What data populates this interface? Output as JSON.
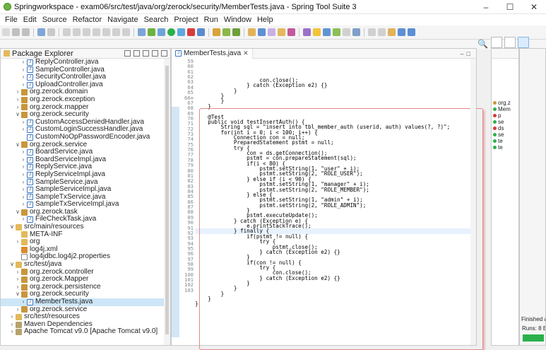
{
  "window": {
    "title": "Springworkspace - exam06/src/test/java/org/zerock/security/MemberTests.java - Spring Tool Suite 3",
    "controls": [
      "–",
      "☐",
      "✕"
    ]
  },
  "menu": [
    "File",
    "Edit",
    "Source",
    "Refactor",
    "Navigate",
    "Search",
    "Project",
    "Run",
    "Window",
    "Help"
  ],
  "package_explorer": {
    "title": "Package Explorer",
    "tree": [
      {
        "label": "ReplyController.java",
        "indent": 3,
        "icon": "java",
        "arrow": ">"
      },
      {
        "label": "SampleController.java",
        "indent": 3,
        "icon": "java",
        "arrow": ">"
      },
      {
        "label": "SecurityController.java",
        "indent": 3,
        "icon": "java",
        "arrow": ">"
      },
      {
        "label": "UploadController.java",
        "indent": 3,
        "icon": "java",
        "arrow": ">"
      },
      {
        "label": "org.zerock.domain",
        "indent": 2,
        "icon": "pkgi",
        "arrow": ">"
      },
      {
        "label": "org.zerock.exception",
        "indent": 2,
        "icon": "pkgi",
        "arrow": ">"
      },
      {
        "label": "org.zerock.mapper",
        "indent": 2,
        "icon": "pkgi",
        "arrow": ">"
      },
      {
        "label": "org.zerock.security",
        "indent": 2,
        "icon": "pkgi",
        "arrow": "v"
      },
      {
        "label": "CustomAccessDeniedHandler.java",
        "indent": 3,
        "icon": "java",
        "arrow": ">"
      },
      {
        "label": "CustomLoginSuccessHandler.java",
        "indent": 3,
        "icon": "java",
        "arrow": ">"
      },
      {
        "label": "CustomNoOpPasswordEncoder.java",
        "indent": 3,
        "icon": "java",
        "arrow": ""
      },
      {
        "label": "org.zerock.service",
        "indent": 2,
        "icon": "pkgi",
        "arrow": "v"
      },
      {
        "label": "BoardService.java",
        "indent": 3,
        "icon": "java",
        "arrow": ">"
      },
      {
        "label": "BoardServiceImpl.java",
        "indent": 3,
        "icon": "java",
        "arrow": ">"
      },
      {
        "label": "ReplyService.java",
        "indent": 3,
        "icon": "java",
        "arrow": ">"
      },
      {
        "label": "ReplyServiceImpl.java",
        "indent": 3,
        "icon": "java",
        "arrow": ">"
      },
      {
        "label": "SampleService.java",
        "indent": 3,
        "icon": "java",
        "arrow": ">"
      },
      {
        "label": "SampleServiceImpl.java",
        "indent": 3,
        "icon": "java",
        "arrow": ">"
      },
      {
        "label": "SampleTxService.java",
        "indent": 3,
        "icon": "java",
        "arrow": ">"
      },
      {
        "label": "SampleTxServiceImpl.java",
        "indent": 3,
        "icon": "java",
        "arrow": ">"
      },
      {
        "label": "org.zerock.task",
        "indent": 2,
        "icon": "pkgi",
        "arrow": "v"
      },
      {
        "label": "FileCheckTask.java",
        "indent": 3,
        "icon": "java",
        "arrow": ">"
      },
      {
        "label": "src/main/resources",
        "indent": 1,
        "icon": "folder",
        "arrow": "v"
      },
      {
        "label": "META-INF",
        "indent": 2,
        "icon": "folder",
        "arrow": ""
      },
      {
        "label": "org",
        "indent": 2,
        "icon": "folder",
        "arrow": ">"
      },
      {
        "label": "log4j.xml",
        "indent": 2,
        "icon": "xml",
        "arrow": ""
      },
      {
        "label": "log4jdbc.log4j2.properties",
        "indent": 2,
        "icon": "file",
        "arrow": ""
      },
      {
        "label": "src/test/java",
        "indent": 1,
        "icon": "folder",
        "arrow": "v"
      },
      {
        "label": "org.zerock.controller",
        "indent": 2,
        "icon": "pkgi",
        "arrow": ">"
      },
      {
        "label": "org.zerock.Mapper",
        "indent": 2,
        "icon": "pkgi",
        "arrow": ">"
      },
      {
        "label": "org.zerock.persistence",
        "indent": 2,
        "icon": "pkgi",
        "arrow": ">"
      },
      {
        "label": "org.zerock.security",
        "indent": 2,
        "icon": "pkgi",
        "arrow": "v"
      },
      {
        "label": "MemberTests.java",
        "indent": 3,
        "icon": "java",
        "arrow": ">",
        "selected": true
      },
      {
        "label": "org.zerock.service",
        "indent": 2,
        "icon": "pkgi",
        "arrow": ">"
      },
      {
        "label": "src/test/resources",
        "indent": 1,
        "icon": "folder",
        "arrow": ">"
      },
      {
        "label": "Maven Dependencies",
        "indent": 1,
        "icon": "lib",
        "arrow": ">"
      },
      {
        "label": "Apache Tomcat v9.0 [Apache Tomcat v9.0]",
        "indent": 1,
        "icon": "lib",
        "arrow": ">"
      }
    ]
  },
  "editor": {
    "tab_label": "MemberTests.java",
    "lines": [
      {
        "n": "59",
        "t": "                    con.close();"
      },
      {
        "n": "60",
        "t": "                } catch (Exception e2) {}"
      },
      {
        "n": "61",
        "t": "            }"
      },
      {
        "n": "62",
        "t": "        }"
      },
      {
        "n": "63",
        "t": "        }"
      },
      {
        "n": "64",
        "t": "    }"
      },
      {
        "n": "65",
        "t": ""
      },
      {
        "n": "66⊖",
        "t": "    @Test"
      },
      {
        "n": "67",
        "t": "    public void testInsertAuth() {"
      },
      {
        "n": "68",
        "t": "        String sql = \"insert into tbl_member_auth (userid, auth) values(?, ?)\";"
      },
      {
        "n": "69",
        "t": "        for(int i = 0; i < 100; i++) {"
      },
      {
        "n": "70",
        "t": "            Connection con = null;"
      },
      {
        "n": "71",
        "t": "            PreparedStatement pstmt = null;"
      },
      {
        "n": "72",
        "t": "            try {"
      },
      {
        "n": "73",
        "t": "                con = ds.getConnection();"
      },
      {
        "n": "74",
        "t": "                pstmt = con.prepareStatement(sql);"
      },
      {
        "n": "75",
        "t": "                if(i < 80) {"
      },
      {
        "n": "76",
        "t": "                    pstmt.setString(1, \"user\" + i);"
      },
      {
        "n": "77",
        "t": "                    pstmt.setString(2, \"ROLE_USER\");"
      },
      {
        "n": "78",
        "t": "                } else if (i < 90) {"
      },
      {
        "n": "79",
        "t": "                    pstmt.setString(1, \"manager\" + i);"
      },
      {
        "n": "80",
        "t": "                    pstmt.setString(2, \"ROLE_MEMBER\");"
      },
      {
        "n": "81",
        "t": "                } else {"
      },
      {
        "n": "82",
        "t": "                    pstmt.setString(1, \"admin\" + i);"
      },
      {
        "n": "83",
        "t": "                    pstmt.setString(2, \"ROLE_ADMIN\");"
      },
      {
        "n": "84",
        "t": "                }"
      },
      {
        "n": "85",
        "t": "                pstmt.executeUpdate();"
      },
      {
        "n": "86",
        "t": "            } catch (Exception e) {"
      },
      {
        "n": "87",
        "t": "                e.printStackTrace();"
      },
      {
        "n": "88",
        "t": "            } finally {"
      },
      {
        "n": "89",
        "t": "                if(pstmt != null) {"
      },
      {
        "n": "90",
        "t": "                    try {"
      },
      {
        "n": "91",
        "t": "                        pstmt.close();"
      },
      {
        "n": "92",
        "t": "                    } catch (Exception e2) {}"
      },
      {
        "n": "93",
        "t": "                }"
      },
      {
        "n": "94",
        "t": "                if(con != null) {"
      },
      {
        "n": "95",
        "t": "                    try {"
      },
      {
        "n": "96",
        "t": "                        con.close();"
      },
      {
        "n": "97",
        "t": "                    } catch (Exception e2) {}"
      },
      {
        "n": "98",
        "t": "                }"
      },
      {
        "n": "99",
        "t": "            }"
      },
      {
        "n": "100",
        "t": "        }"
      },
      {
        "n": "101",
        "t": "    }"
      },
      {
        "n": "102",
        "t": "}"
      },
      {
        "n": "103",
        "t": ""
      }
    ]
  },
  "outline": {
    "items": [
      "org.z",
      "Mem",
      "p",
      "se",
      "ds",
      "se",
      "te",
      "te"
    ]
  },
  "junit": {
    "finished": "Finished after",
    "runs_label": "Runs:",
    "runs_value": "8 E"
  }
}
